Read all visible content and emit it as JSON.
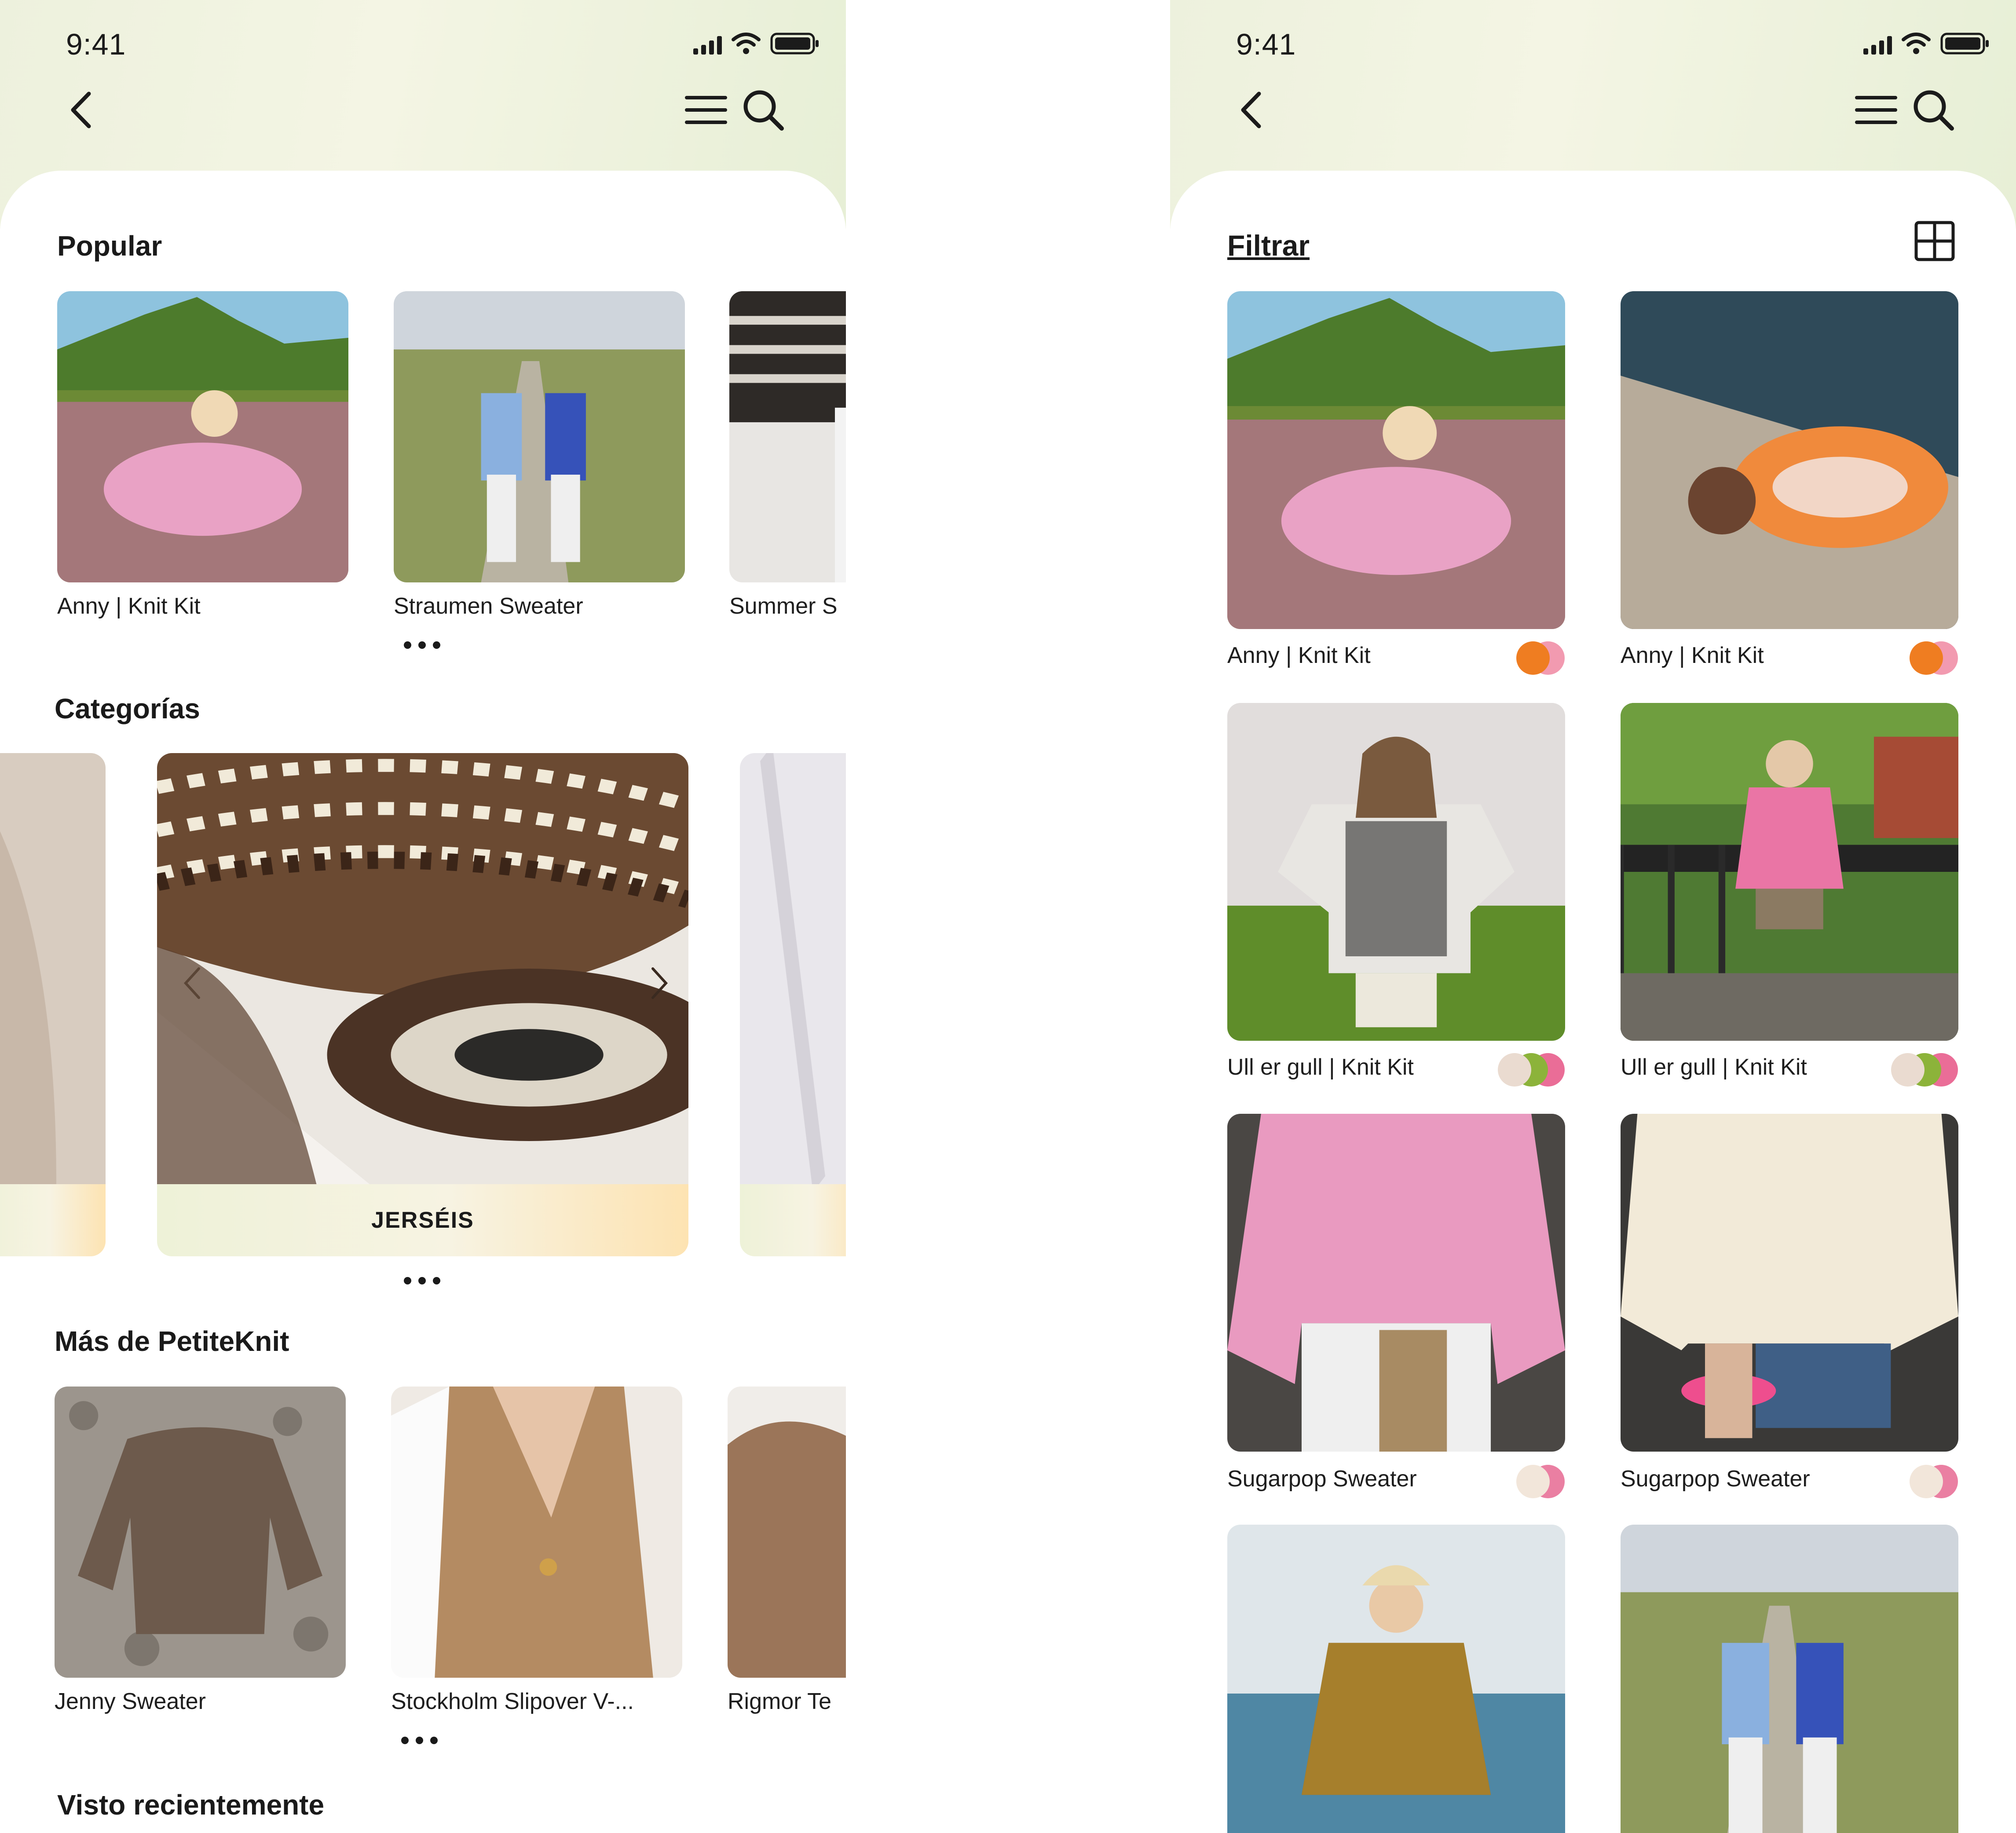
{
  "status": {
    "time": "9:41"
  },
  "left": {
    "popular": {
      "title": "Popular",
      "items": [
        "Anny | Knit Kit",
        "Straumen Sweater",
        "Summer S"
      ]
    },
    "categories": {
      "title": "Categorías",
      "center_label": "JERSÉIS"
    },
    "more": {
      "title": "Más de PetiteKnit",
      "items": [
        "Jenny Sweater",
        "Stockholm Slipover V-...",
        "Rigmor Te"
      ]
    },
    "recent": {
      "title": "Visto recientemente"
    }
  },
  "right": {
    "filter_label": "Filtrar",
    "products": [
      {
        "name": "Anny | Knit Kit",
        "swatches": [
          "#ef7d21",
          "#f29ab0"
        ]
      },
      {
        "name": "Anny | Knit Kit",
        "swatches": [
          "#ef7d21",
          "#f29ab0"
        ]
      },
      {
        "name": "Ull er gull | Knit Kit",
        "swatches": [
          "#eadbd0",
          "#8cb33a",
          "#ea6d97"
        ]
      },
      {
        "name": "Ull er gull | Knit Kit",
        "swatches": [
          "#eadbd0",
          "#8cb33a",
          "#ea6d97"
        ]
      },
      {
        "name": "Sugarpop Sweater",
        "swatches": [
          "#f2e6da",
          "#ea7fa2"
        ]
      },
      {
        "name": "Sugarpop Sweater",
        "swatches": [
          "#f2e6da",
          "#ea7fa2"
        ]
      }
    ]
  },
  "icons": [
    "back-chevron-icon",
    "menu-icon",
    "search-icon",
    "grid-view-icon",
    "signal-icon",
    "wifi-icon",
    "battery-icon"
  ]
}
